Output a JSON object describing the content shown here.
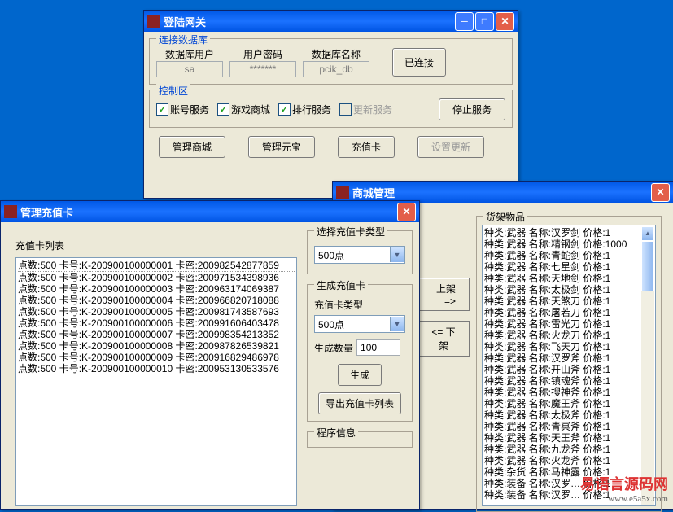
{
  "gateway": {
    "title": "登陆网关",
    "db_group": "连接数据库",
    "db_user_lbl": "数据库用户",
    "db_user": "sa",
    "db_pwd_lbl": "用户密码",
    "db_pwd": "*******",
    "db_name_lbl": "数据库名称",
    "db_name": "pcik_db",
    "connected_btn": "已连接",
    "ctrl_group": "控制区",
    "cb_account": "账号服务",
    "cb_mall": "游戏商城",
    "cb_rank": "排行服务",
    "cb_update": "更新服务",
    "stop_btn": "停止服务",
    "btn_mall": "管理商城",
    "btn_gold": "管理元宝",
    "btn_card": "充值卡",
    "btn_update": "设置更新"
  },
  "card": {
    "title": "管理充值卡",
    "list_group": "充值卡列表",
    "rows": [
      "点数:500 卡号:K-200900100000001 卡密:200982542877859",
      "点数:500 卡号:K-200900100000002 卡密:200971534398936",
      "点数:500 卡号:K-200900100000003 卡密:200963174069387",
      "点数:500 卡号:K-200900100000004 卡密:200966820718088",
      "点数:500 卡号:K-200900100000005 卡密:200981743587693",
      "点数:500 卡号:K-200900100000006 卡密:200991606403478",
      "点数:500 卡号:K-200900100000007 卡密:200998354213352",
      "点数:500 卡号:K-200900100000008 卡密:200987826539821",
      "点数:500 卡号:K-200900100000009 卡密:200916829486978",
      "点数:500 卡号:K-200900100000010 卡密:200953130533576"
    ],
    "select_group": "选择充值卡类型",
    "card_type": "500点",
    "gen_group": "生成充值卡",
    "gen_type_lbl": "充值卡类型",
    "gen_type": "500点",
    "gen_count_lbl": "生成数量",
    "gen_count": "100",
    "gen_btn": "生成",
    "export_btn": "导出充值卡列表",
    "info_group": "程序信息"
  },
  "mall": {
    "title": "商城管理",
    "items_group": "货架物品",
    "btn_up": "上架 =>",
    "btn_down": "<= 下架",
    "rows": [
      "种类:武器 名称:汉罗剑  价格:1",
      "种类:武器 名称:精钢剑  价格:1000",
      "种类:武器 名称:青蛇剑  价格:1",
      "种类:武器 名称:七星剑  价格:1",
      "种类:武器 名称:天地剑  价格:1",
      "种类:武器 名称:太极剑  价格:1",
      "种类:武器 名称:天煞刀  价格:1",
      "种类:武器 名称:屠若刀  价格:1",
      "种类:武器 名称:雷光刀  价格:1",
      "种类:武器 名称:火龙刀  价格:1",
      "种类:武器 名称:飞天刀  价格:1",
      "种类:武器 名称:汉罗斧  价格:1",
      "种类:武器 名称:开山斧  价格:1",
      "种类:武器 名称:镇魂斧  价格:1",
      "种类:武器 名称:搜神斧  价格:1",
      "种类:武器 名称:魔王斧  价格:1",
      "种类:武器 名称:太极斧  价格:1",
      "种类:武器 名称:青冥斧  价格:1",
      "种类:武器 名称:天王斧  价格:1",
      "种类:武器 名称:九龙斧  价格:1",
      "种类:武器 名称:火龙斧  价格:1",
      "种类:杂货 名称:马神露  价格:1",
      "种类:装备 名称:汉罗…  价格:1",
      "种类:装备 名称:汉罗…  价格:1"
    ]
  },
  "watermark": {
    "main": "易语言源码网",
    "url": "www.e5a5x.com"
  }
}
